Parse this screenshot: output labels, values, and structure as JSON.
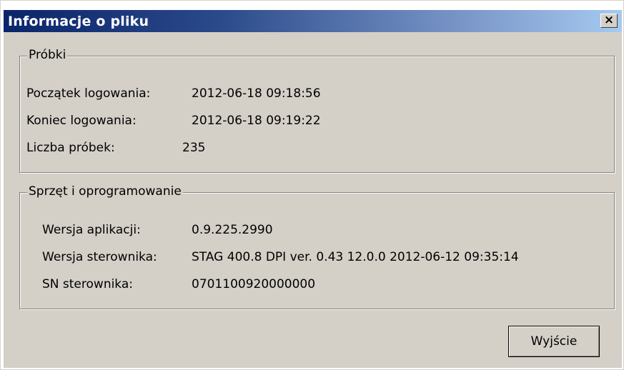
{
  "window": {
    "title": "Informacje o pliku",
    "close_glyph": "×"
  },
  "samples": {
    "label": "Próbki",
    "rows": [
      {
        "key": "Początek logowania:",
        "value": "2012-06-18 09:18:56"
      },
      {
        "key": "Koniec logowania:",
        "value": "2012-06-18 09:19:22"
      },
      {
        "key": "Liczba próbek:",
        "value": "235"
      }
    ]
  },
  "hardware": {
    "label": "Sprzęt i oprogramowanie",
    "rows": [
      {
        "key": "Wersja aplikacji:",
        "value": "0.9.225.2990"
      },
      {
        "key": "Wersja sterownika:",
        "value": "STAG 400.8 DPI ver. 0.43 12.0.0 2012-06-12 09:35:14"
      },
      {
        "key": "SN sterownika:",
        "value": "0701100920000000"
      }
    ]
  },
  "buttons": {
    "exit": "Wyjście"
  }
}
